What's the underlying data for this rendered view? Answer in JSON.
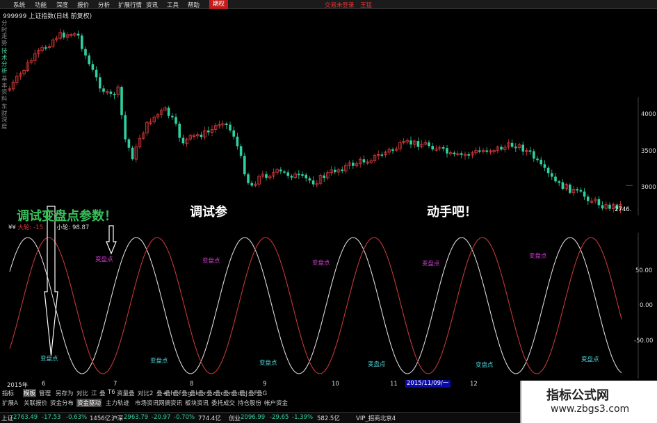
{
  "menu": {
    "items": [
      "系统",
      "功能",
      "深度",
      "报价",
      "分析",
      "扩展行情",
      "资讯",
      "工具",
      "帮助"
    ],
    "active": "期权",
    "right_brand": "交易未登录",
    "right_user": "王猛"
  },
  "chart_title": "999999 上证指数(日线 前复权)",
  "left_tabs": [
    "分时走势",
    "技术分析",
    "基本资料",
    "东财深度"
  ],
  "overlays": {
    "left": "调试变盘点参数！",
    "mid": "调试参",
    "right": "动手吧！"
  },
  "indicator_header": {
    "prefix": "¥¥",
    "big_label": "大轮: -15.",
    "small_label": "小轮: 98.87"
  },
  "turning_point_label": "变盘点",
  "price_axis": [
    "4000",
    "3500",
    "3000"
  ],
  "last_price_tag": "2746.",
  "indicator_axis": [
    "50.00",
    "0.00",
    "-50.00"
  ],
  "x_axis": [
    "2015年",
    "6",
    "7",
    "8",
    "9",
    "10",
    "11",
    "12"
  ],
  "date_box": "2015/11/09/一",
  "tabs_row1": [
    "指标",
    "模板",
    "管理",
    "另存为",
    "对比",
    "江",
    "叠",
    "T6",
    "资量叠",
    "对比2",
    "叠+",
    "叠h",
    "叠f",
    "叠g",
    "叠k",
    "叠r",
    "叠z",
    "叠c",
    "叠n",
    "叠d",
    "叠J",
    "叠F",
    "叠G"
  ],
  "tabs_row1_selected": "模板",
  "tabs_row2": [
    "扩展A",
    "关联报价",
    "资金分布",
    "资金驱动",
    "主力轨迹",
    "市场资讯",
    "网摘资讯",
    "板块资讯",
    "委托成交",
    "持仓股份",
    "帐户资金"
  ],
  "status": {
    "sh_label": "上证",
    "sh_value": "2763.49",
    "sh_change": "-17.53",
    "sh_pct": "-0.63%",
    "sh_amount": "1456亿",
    "hs_label": "沪深",
    "hs_value": "2963.79",
    "hs_change": "-20.97",
    "hs_pct": "-0.70%",
    "hs_amount": "774.4亿",
    "cy_label": "创业",
    "cy_value": "2096.99",
    "cy_change": "-29.65",
    "cy_pct": "-1.39%",
    "cy_amount": "582.5亿",
    "vip": "VIP_招商北京4"
  },
  "watermark": {
    "title": "指标公式网",
    "url": "www.zbgs3.com"
  },
  "colors": {
    "up": "#e03c3c",
    "down": "#2fd0a0",
    "white_wave": "#d8d8d8",
    "red_wave": "#c43838",
    "top_label": "#d23bd2",
    "bottom_label": "#4fd2d8",
    "overlay_green": "#37c05b"
  },
  "chart_data": {
    "type": "line",
    "title": "999999 上证指数(日线 前复权)",
    "price_axis_ticks": [
      3000,
      3500,
      4000
    ],
    "indicator_axis_ticks": [
      -50,
      0,
      50
    ],
    "x_categories": [
      "2015年",
      "6",
      "7",
      "8",
      "9",
      "10",
      "11",
      "12"
    ],
    "series": [
      {
        "name": "大轮",
        "style": "red sinusoid"
      },
      {
        "name": "小轮",
        "value": 98.87,
        "style": "white sinusoid"
      }
    ]
  }
}
